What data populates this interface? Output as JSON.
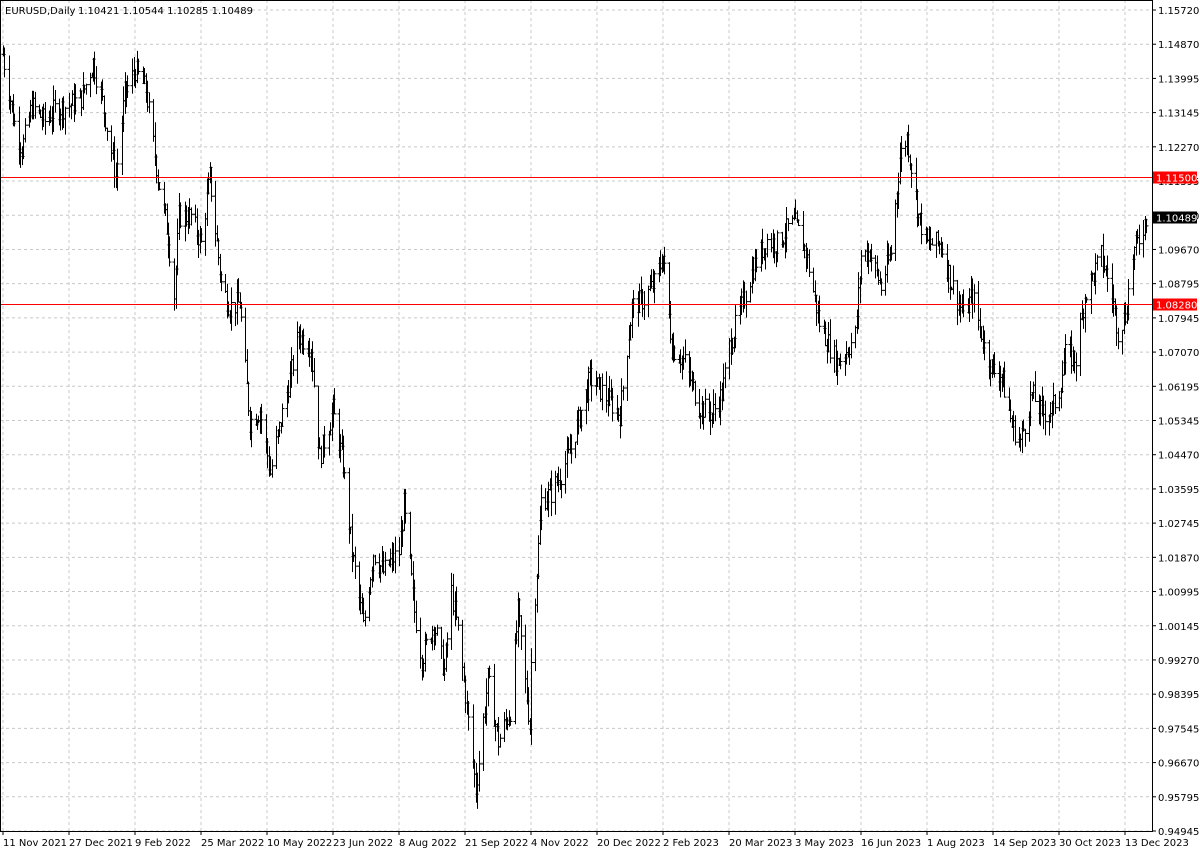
{
  "header": {
    "symbol": "EURUSD,Daily",
    "ohlc": "1.10421 1.10544 1.10285 1.10489"
  },
  "colors": {
    "background": "#ffffff",
    "grid": "#c8c8c8",
    "bars": "#000000",
    "level_line": "#ff0000",
    "level_label_bg": "#ff0000",
    "level_label_text": "#ffffff",
    "price_label_bg": "#000000",
    "price_label_text": "#ffffff"
  },
  "chart_data": {
    "type": "bar",
    "symbol": "EURUSD",
    "timeframe": "Daily",
    "title": "EURUSD,Daily",
    "ylim": [
      0.94945,
      1.1572
    ],
    "y_ticks": [
      "1.15720",
      "1.14870",
      "1.13995",
      "1.13145",
      "1.12270",
      "1.11395",
      "1.10520",
      "1.09670",
      "1.08795",
      "1.07945",
      "1.07070",
      "1.06195",
      "1.05345",
      "1.04470",
      "1.03595",
      "1.02745",
      "1.01870",
      "1.00995",
      "1.00145",
      "0.99270",
      "0.98395",
      "0.97545",
      "0.96670",
      "0.95795",
      "0.94945"
    ],
    "x_ticks": [
      "11 Nov 2021",
      "27 Dec 2021",
      "9 Feb 2022",
      "25 Mar 2022",
      "10 May 2022",
      "23 Jun 2022",
      "8 Aug 2022",
      "21 Sep 2022",
      "4 Nov 2022",
      "20 Dec 2022",
      "2 Feb 2023",
      "20 Mar 2023",
      "3 May 2023",
      "16 Jun 2023",
      "1 Aug 2023",
      "14 Sep 2023",
      "30 Oct 2023",
      "13 Dec 2023"
    ],
    "horizontal_levels": [
      {
        "value": 1.115,
        "label": "1.11500"
      },
      {
        "value": 1.0828,
        "label": "1.08280"
      }
    ],
    "current_price": {
      "value": 1.10489,
      "label": "1.10489"
    },
    "price_path": [
      [
        "11 Nov 2021",
        1.146
      ],
      [
        "18 Nov 2021",
        1.13
      ],
      [
        "24 Nov 2021",
        1.122
      ],
      [
        "1 Dec 2021",
        1.133
      ],
      [
        "10 Dec 2021",
        1.129
      ],
      [
        "17 Dec 2021",
        1.132
      ],
      [
        "27 Dec 2021",
        1.133
      ],
      [
        "4 Jan 2022",
        1.135
      ],
      [
        "12 Jan 2022",
        1.144
      ],
      [
        "18 Jan 2022",
        1.134
      ],
      [
        "27 Jan 2022",
        1.115
      ],
      [
        "2 Feb 2022",
        1.136
      ],
      [
        "9 Feb 2022",
        1.142
      ],
      [
        "16 Feb 2022",
        1.137
      ],
      [
        "24 Feb 2022",
        1.115
      ],
      [
        "3 Mar 2022",
        1.1
      ],
      [
        "7 Mar 2022",
        1.085
      ],
      [
        "10 Mar 2022",
        1.105
      ],
      [
        "18 Mar 2022",
        1.105
      ],
      [
        "25 Mar 2022",
        1.098
      ],
      [
        "31 Mar 2022",
        1.115
      ],
      [
        "8 Apr 2022",
        1.088
      ],
      [
        "14 Apr 2022",
        1.082
      ],
      [
        "21 Apr 2022",
        1.083
      ],
      [
        "28 Apr 2022",
        1.053
      ],
      [
        "5 May 2022",
        1.056
      ],
      [
        "12 May 2022",
        1.04
      ],
      [
        "20 May 2022",
        1.055
      ],
      [
        "31 May 2022",
        1.075
      ],
      [
        "8 Jun 2022",
        1.072
      ],
      [
        "14 Jun 2022",
        1.044
      ],
      [
        "23 Jun 2022",
        1.056
      ],
      [
        "30 Jun 2022",
        1.042
      ],
      [
        "6 Jul 2022",
        1.02
      ],
      [
        "14 Jul 2022",
        1.001
      ],
      [
        "21 Jul 2022",
        1.02
      ],
      [
        "28 Jul 2022",
        1.015
      ],
      [
        "3 Aug 2022",
        1.018
      ],
      [
        "8 Aug 2022",
        1.02
      ],
      [
        "11 Aug 2022",
        1.032
      ],
      [
        "18 Aug 2022",
        1.005
      ],
      [
        "23 Aug 2022",
        0.993
      ],
      [
        "31 Aug 2022",
        1.002
      ],
      [
        "7 Sep 2022",
        0.99
      ],
      [
        "12 Sep 2022",
        1.01
      ],
      [
        "16 Sep 2022",
        1.0
      ],
      [
        "21 Sep 2022",
        0.984
      ],
      [
        "28 Sep 2022",
        0.96
      ],
      [
        "6 Oct 2022",
        0.988
      ],
      [
        "13 Oct 2022",
        0.972
      ],
      [
        "21 Oct 2022",
        0.98
      ],
      [
        "26 Oct 2022",
        1.005
      ],
      [
        "3 Nov 2022",
        0.976
      ],
      [
        "4 Nov 2022",
        0.992
      ],
      [
        "11 Nov 2022",
        1.033
      ],
      [
        "18 Nov 2022",
        1.035
      ],
      [
        "25 Nov 2022",
        1.04
      ],
      [
        "1 Dec 2022",
        1.045
      ],
      [
        "15 Dec 2022",
        1.064
      ],
      [
        "20 Dec 2022",
        1.062
      ],
      [
        "4 Jan 2023",
        1.055
      ],
      [
        "12 Jan 2023",
        1.082
      ],
      [
        "20 Jan 2023",
        1.084
      ],
      [
        "27 Jan 2023",
        1.088
      ],
      [
        "2 Feb 2023",
        1.095
      ],
      [
        "8 Feb 2023",
        1.072
      ],
      [
        "17 Feb 2023",
        1.068
      ],
      [
        "27 Feb 2023",
        1.057
      ],
      [
        "8 Mar 2023",
        1.055
      ],
      [
        "15 Mar 2023",
        1.06
      ],
      [
        "20 Mar 2023",
        1.072
      ],
      [
        "28 Mar 2023",
        1.082
      ],
      [
        "5 Apr 2023",
        1.092
      ],
      [
        "14 Apr 2023",
        1.099
      ],
      [
        "21 Apr 2023",
        1.098
      ],
      [
        "28 Apr 2023",
        1.102
      ],
      [
        "3 May 2023",
        1.103
      ],
      [
        "10 May 2023",
        1.096
      ],
      [
        "19 May 2023",
        1.078
      ],
      [
        "26 May 2023",
        1.072
      ],
      [
        "31 May 2023",
        1.068
      ],
      [
        "6 Jun 2023",
        1.071
      ],
      [
        "12 Jun 2023",
        1.075
      ],
      [
        "16 Jun 2023",
        1.095
      ],
      [
        "22 Jun 2023",
        1.096
      ],
      [
        "30 Jun 2023",
        1.087
      ],
      [
        "7 Jul 2023",
        1.096
      ],
      [
        "13 Jul 2023",
        1.12
      ],
      [
        "18 Jul 2023",
        1.125
      ],
      [
        "26 Jul 2023",
        1.105
      ],
      [
        "1 Aug 2023",
        1.098
      ],
      [
        "10 Aug 2023",
        1.098
      ],
      [
        "17 Aug 2023",
        1.088
      ],
      [
        "25 Aug 2023",
        1.08
      ],
      [
        "31 Aug 2023",
        1.085
      ],
      [
        "8 Sep 2023",
        1.072
      ],
      [
        "14 Sep 2023",
        1.066
      ],
      [
        "20 Sep 2023",
        1.065
      ],
      [
        "27 Sep 2023",
        1.052
      ],
      [
        "3 Oct 2023",
        1.048
      ],
      [
        "11 Oct 2023",
        1.06
      ],
      [
        "18 Oct 2023",
        1.055
      ],
      [
        "25 Oct 2023",
        1.056
      ],
      [
        "30 Oct 2023",
        1.061
      ],
      [
        "3 Nov 2023",
        1.07
      ],
      [
        "10 Nov 2023",
        1.069
      ],
      [
        "16 Nov 2023",
        1.085
      ],
      [
        "27 Nov 2023",
        1.095
      ],
      [
        "4 Dec 2023",
        1.085
      ],
      [
        "8 Dec 2023",
        1.076
      ],
      [
        "13 Dec 2023",
        1.08
      ],
      [
        "18 Dec 2023",
        1.095
      ],
      [
        "27 Dec 2023",
        1.1048
      ]
    ]
  }
}
